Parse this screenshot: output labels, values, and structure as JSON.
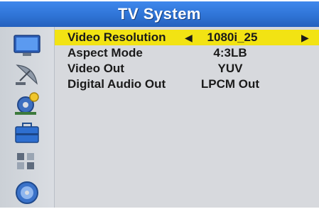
{
  "title": "TV System",
  "sidebar": {
    "icons": [
      "monitor-icon",
      "satellite-dish-icon",
      "settings-gear-icon",
      "briefcase-icon",
      "media-icon",
      "disc-icon"
    ]
  },
  "menu": {
    "items": [
      {
        "label": "Video Resolution",
        "value": "1080i_25",
        "selected": true,
        "left_arrow": "◀",
        "right_arrow": "▶"
      },
      {
        "label": "Aspect Mode",
        "value": "4:3LB"
      },
      {
        "label": "Video Out",
        "value": "YUV"
      },
      {
        "label": "Digital Audio Out",
        "value": "LPCM Out"
      }
    ]
  },
  "colors": {
    "title_bar": "#2f74d6",
    "selection": "#f2e313",
    "panel": "#d7d9dd",
    "sidebar": "#cfd3d9"
  }
}
